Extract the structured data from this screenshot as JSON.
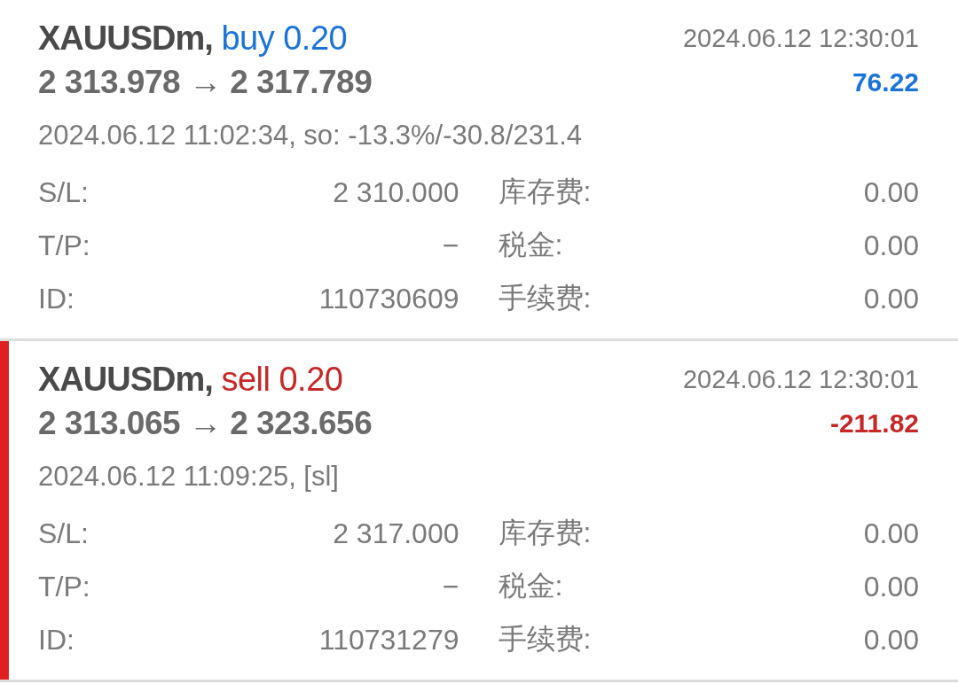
{
  "trades": [
    {
      "selected": false,
      "symbol": "XAUUSDm,",
      "side": {
        "kind": "buy",
        "text": "buy 0.20"
      },
      "time": "2024.06.12 12:30:01",
      "prices": "2 313.978 → 2 317.789",
      "profit": {
        "kind": "gain",
        "text": "76.22"
      },
      "comment": "2024.06.12 11:02:34, so: -13.3%/-30.8/231.4",
      "details": [
        {
          "label": "S/L:",
          "value": "2 310.000"
        },
        {
          "label": "库存费:",
          "value": "0.00"
        },
        {
          "label": "T/P:",
          "value": "−"
        },
        {
          "label": "税金:",
          "value": "0.00"
        },
        {
          "label": "ID:",
          "value": "110730609"
        },
        {
          "label": "手续费:",
          "value": "0.00"
        }
      ]
    },
    {
      "selected": true,
      "symbol": "XAUUSDm,",
      "side": {
        "kind": "sell",
        "text": "sell 0.20"
      },
      "time": "2024.06.12 12:30:01",
      "prices": "2 313.065 → 2 323.656",
      "profit": {
        "kind": "loss",
        "text": "-211.82"
      },
      "comment": "2024.06.12 11:09:25, [sl]",
      "details": [
        {
          "label": "S/L:",
          "value": "2 317.000"
        },
        {
          "label": "库存费:",
          "value": "0.00"
        },
        {
          "label": "T/P:",
          "value": "−"
        },
        {
          "label": "税金:",
          "value": "0.00"
        },
        {
          "label": "ID:",
          "value": "110731279"
        },
        {
          "label": "手续费:",
          "value": "0.00"
        }
      ]
    }
  ]
}
